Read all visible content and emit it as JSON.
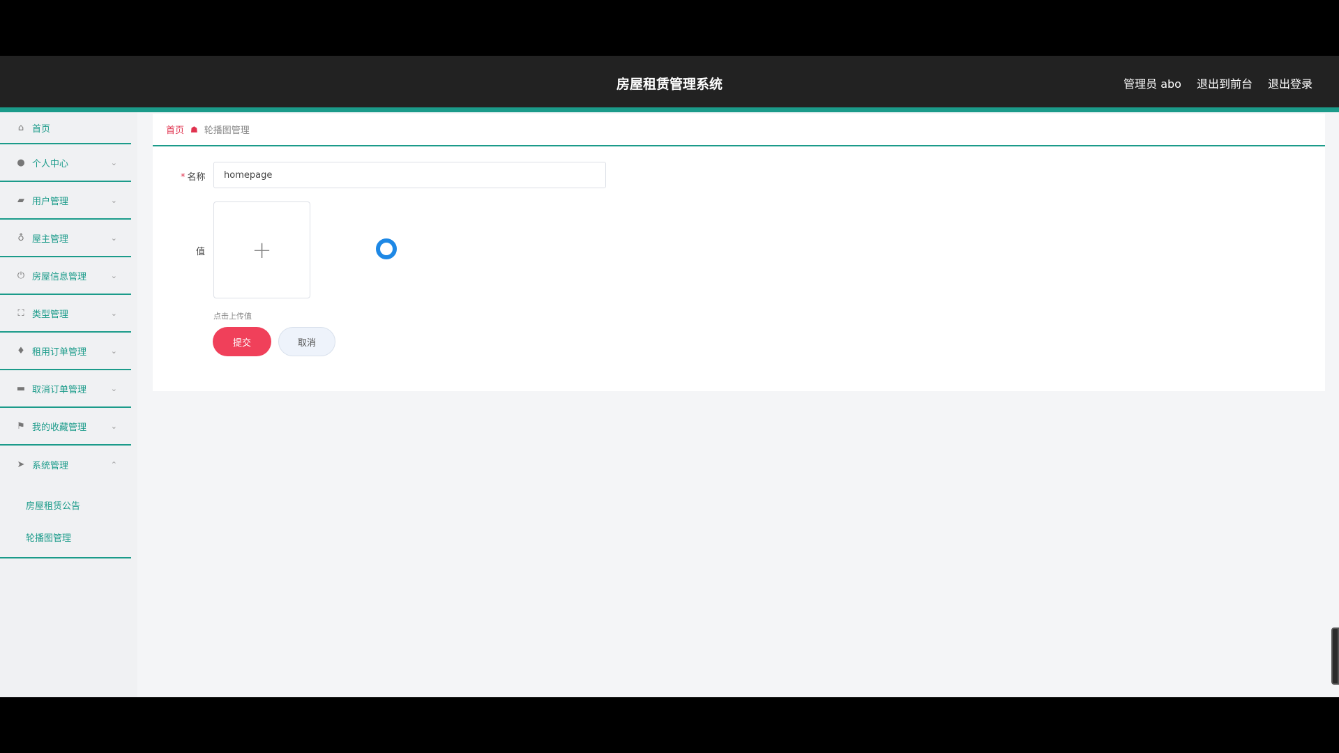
{
  "header": {
    "title": "房屋租赁管理系统",
    "user_label": "管理员 abo",
    "front_link": "退出到前台",
    "logout_link": "退出登录"
  },
  "sidebar": {
    "items": [
      {
        "label": "首页",
        "icon": "home-icon"
      },
      {
        "label": "个人中心",
        "icon": "user-icon"
      },
      {
        "label": "用户管理",
        "icon": "chart-icon"
      },
      {
        "label": "屋主管理",
        "icon": "mic-icon"
      },
      {
        "label": "房屋信息管理",
        "icon": "power-icon"
      },
      {
        "label": "类型管理",
        "icon": "expand-icon"
      },
      {
        "label": "租用订单管理",
        "icon": "bulb-icon"
      },
      {
        "label": "取消订单管理",
        "icon": "briefcase-icon"
      },
      {
        "label": "我的收藏管理",
        "icon": "flag-icon"
      },
      {
        "label": "系统管理",
        "icon": "send-icon"
      }
    ],
    "submenu": [
      {
        "label": "房屋租赁公告"
      },
      {
        "label": "轮播图管理"
      }
    ]
  },
  "breadcrumb": {
    "home": "首页",
    "current": "轮播图管理"
  },
  "form": {
    "name_label": "名称",
    "name_value": "homepage",
    "value_label": "值",
    "upload_tip": "点击上传值",
    "submit_label": "提交",
    "cancel_label": "取消"
  }
}
